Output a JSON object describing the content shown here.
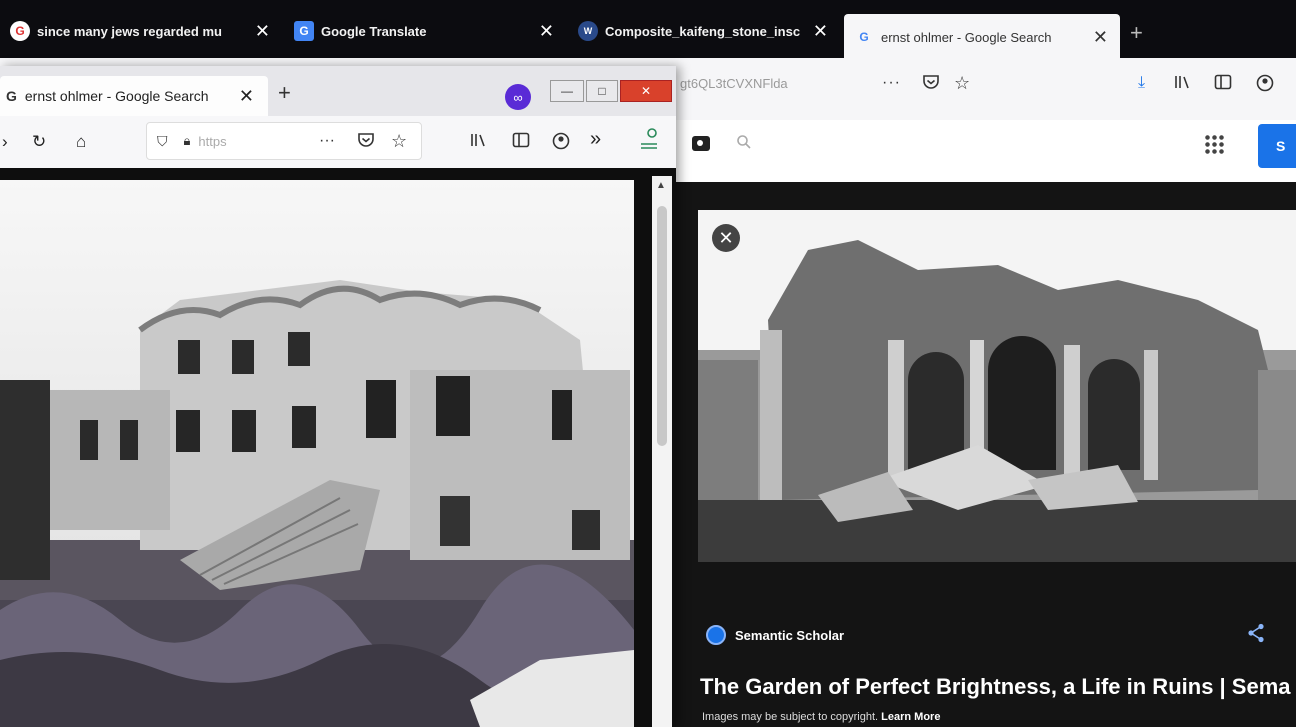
{
  "back_window": {
    "tabs": [
      {
        "title": "since many jews regarded mu",
        "icon": "google-g-icon",
        "close": "✕"
      },
      {
        "title": "Google Translate",
        "icon": "google-translate-icon",
        "close": "✕"
      },
      {
        "title": "Composite_kaifeng_stone_insc",
        "icon": "wikipedia-icon",
        "close": "✕"
      },
      {
        "title": "ernst ohlmer - Google Search",
        "icon": "google-g-icon",
        "close": "✕",
        "active": true
      }
    ],
    "new_tab": "+",
    "url_partial": "gt6QL3tCVXNFlda",
    "overflow": "···"
  },
  "front_window": {
    "tab_title": "ernst ohlmer - Google Search",
    "tab_close": "✕",
    "new_tab": "+",
    "url_placeholder": "https",
    "overflow": "···",
    "chevrons": "»"
  },
  "image_result": {
    "source": "Semantic Scholar",
    "title": "The Garden of Perfect Brightness, a Life in Ruins | Sema",
    "copyright_text": "Images may be subject to copyright.",
    "learn_more": "Learn More"
  },
  "colors": {
    "google_blue": "#1a73e8",
    "private_purple": "#5a2bd6",
    "dark_panel": "#141414"
  }
}
